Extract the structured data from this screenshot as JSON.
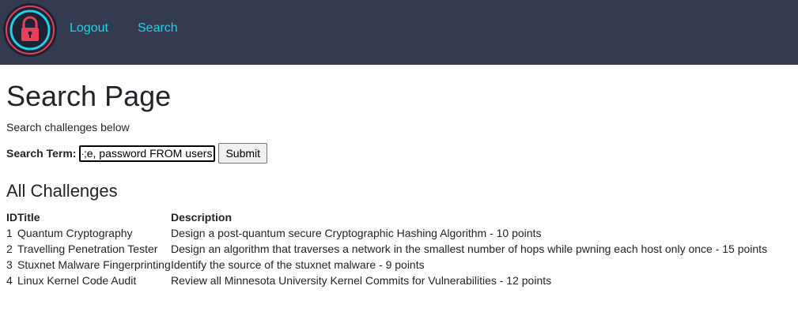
{
  "nav": {
    "logout_label": "Logout",
    "search_label": "Search",
    "accent_color": "#1fd1e6",
    "background_color": "#343a4f"
  },
  "page": {
    "title": "Search Page",
    "subtitle": "Search challenges below"
  },
  "search": {
    "label": "Search Term:",
    "value": "e, password FROM users;--",
    "submit_label": "Submit"
  },
  "challenges": {
    "heading": "All Challenges",
    "columns": [
      "ID",
      "Title",
      "Description"
    ],
    "rows": [
      {
        "id": "1",
        "title": "Quantum Cryptography",
        "description": "Design a post-quantum secure Cryptographic Hashing Algorithm - 10 points"
      },
      {
        "id": "2",
        "title": "Travelling Penetration Tester",
        "description": "Design an algorithm that traverses a network in the smallest number of hops while pwning each host only once - 15 points"
      },
      {
        "id": "3",
        "title": "Stuxnet Malware Fingerprinting",
        "description": "Identify the source of the stuxnet malware - 9 points"
      },
      {
        "id": "4",
        "title": "Linux Kernel Code Audit",
        "description": "Review all Minnesota University Kernel Commits for Vulnerabilities - 12 points"
      }
    ]
  }
}
